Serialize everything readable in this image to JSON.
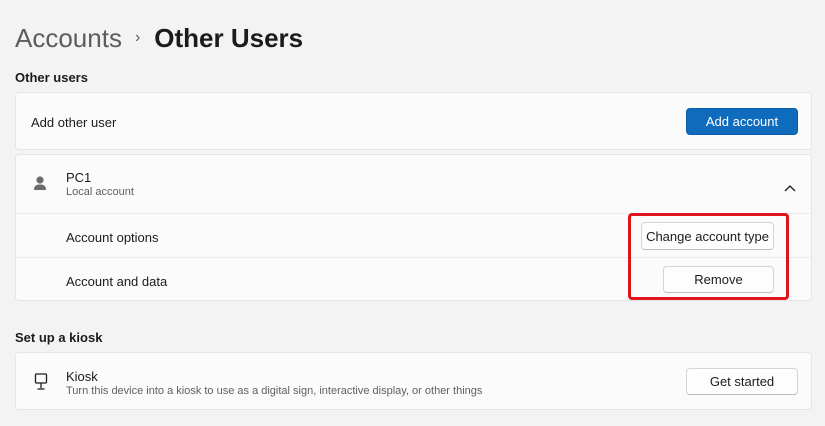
{
  "breadcrumb": {
    "parent": "Accounts",
    "separator": "›",
    "current": "Other Users"
  },
  "other_users": {
    "section_title": "Other users",
    "add_other_user_label": "Add other user",
    "add_account_button": "Add account",
    "user": {
      "name": "PC1",
      "type": "Local account",
      "icon": "person-icon",
      "expand_icon": "chevron-up-icon",
      "account_options_label": "Account options",
      "change_account_type_button": "Change account type",
      "account_and_data_label": "Account and data",
      "remove_button": "Remove"
    }
  },
  "kiosk": {
    "section_title": "Set up a kiosk",
    "title": "Kiosk",
    "description": "Turn this device into a kiosk to use as a digital sign, interactive display, or other things",
    "icon": "kiosk-icon",
    "get_started_button": "Get started"
  },
  "colors": {
    "accent": "#0f6cbd",
    "highlight": "#e0141b",
    "background": "#f3f3f3"
  }
}
